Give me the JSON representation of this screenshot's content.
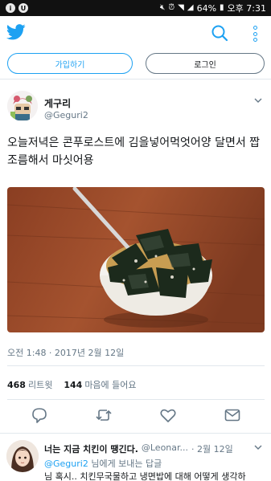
{
  "status_bar": {
    "left_icons": [
      "notification-icon",
      "app-icon"
    ],
    "battery": "64%",
    "time": "오후 7:31"
  },
  "appbar": {
    "logo": "twitter-bird-icon",
    "search": "search-icon",
    "more": "more-vertical-icon"
  },
  "auth": {
    "signup_label": "가입하기",
    "login_label": "로그인"
  },
  "tweet": {
    "name": "게구리",
    "handle": "@Geguri2",
    "text": "오늘저녁은 콘푸로스트에 김을넣어먹엇어양 달면서 짭조름해서 마싯어용",
    "timestamp": "오전 1:48 · 2017년 2월 12일",
    "retweets": "468",
    "retweets_label": "리트윗",
    "likes": "144",
    "likes_label": "마음에 들어요",
    "colors": {
      "accent": "#1da1f2",
      "muted": "#657786",
      "text": "#14171a"
    }
  },
  "actions": [
    "reply-icon",
    "retweet-icon",
    "like-icon",
    "message-icon"
  ],
  "reply": {
    "name": "너는 지금 치킨이 땡긴다.",
    "handle": "@Leonar...",
    "date": "· 2월 12일",
    "replying_to_mention": "@Geguri2",
    "replying_to_suffix": " 님에게 보내는 답글",
    "text": "님 혹시.. 치킨무국물하고 냉면밥에 대해 어떻게 생각하"
  }
}
